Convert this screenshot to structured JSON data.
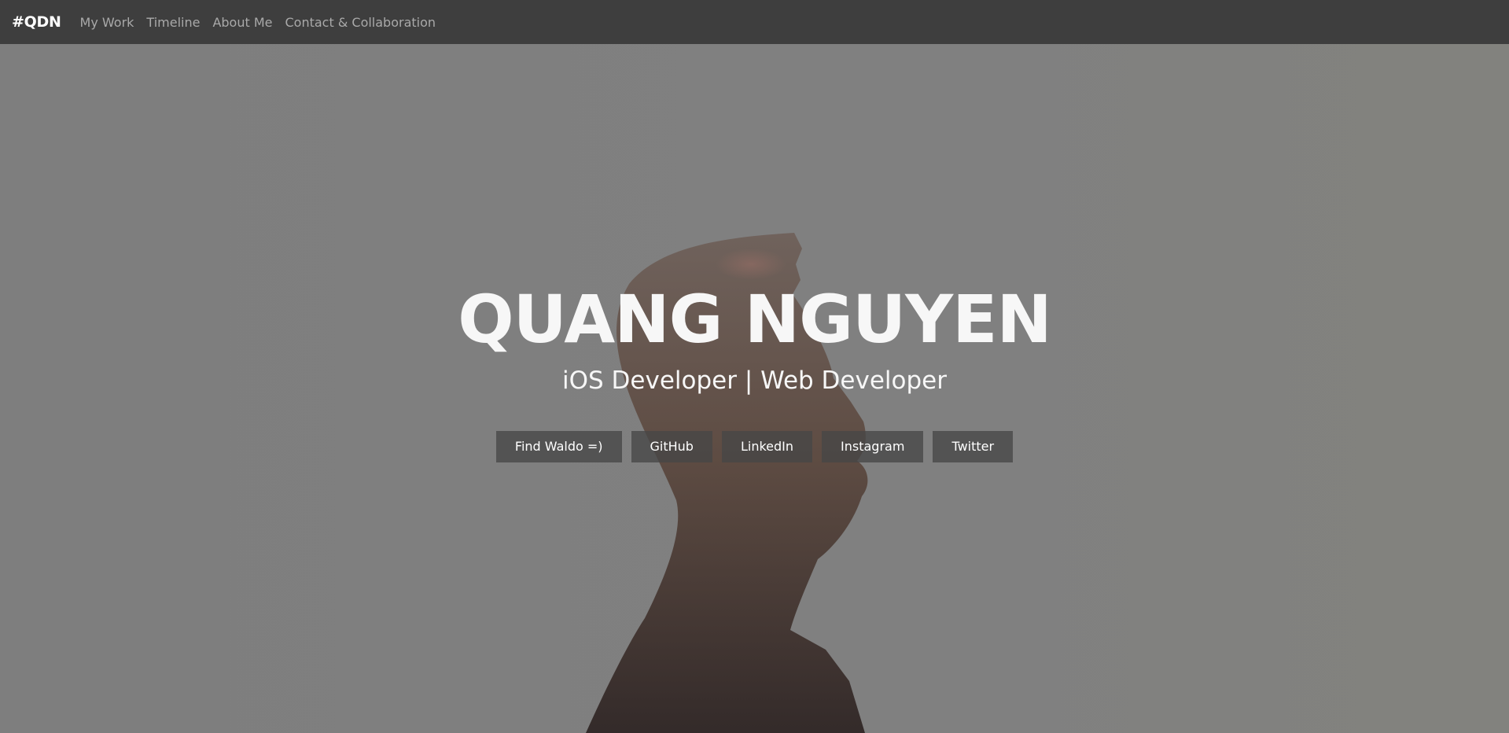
{
  "navbar": {
    "brand": "#QDN",
    "links": [
      "My Work",
      "Timeline",
      "About Me",
      "Contact & Collaboration"
    ]
  },
  "hero": {
    "title": "QUANG NGUYEN",
    "subtitle": "iOS Developer | Web Developer",
    "buttons": [
      "Find Waldo =)",
      "GitHub",
      "LinkedIn",
      "Instagram",
      "Twitter"
    ]
  },
  "colors": {
    "navbar_bg": "#3e3e3e",
    "hero_overlay": "#7f7f7f",
    "text_light": "#f7f7f7",
    "nav_link": "#a9a9a9",
    "button_bg": "#4f4f4f"
  }
}
